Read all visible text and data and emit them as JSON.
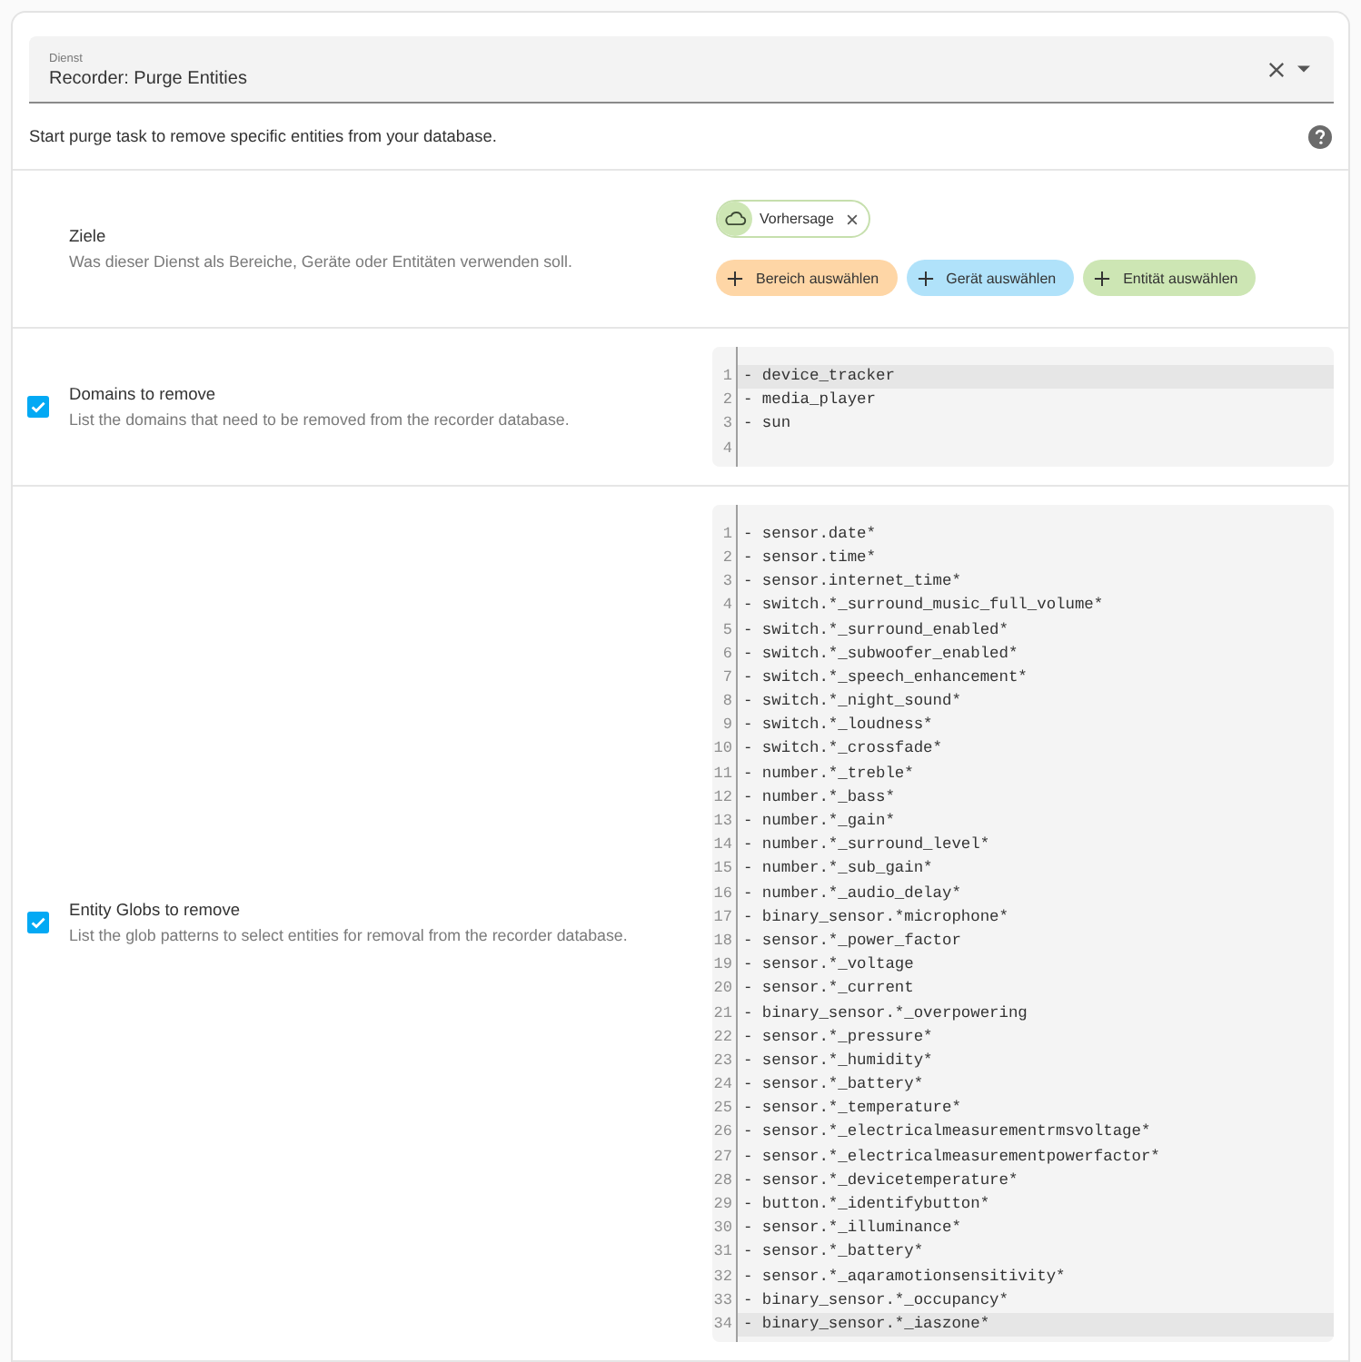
{
  "service_field": {
    "label": "Dienst",
    "value": "Recorder: Purge Entities"
  },
  "description": "Start purge task to remove specific entities from your database.",
  "sections": [
    {
      "kind": "targets",
      "title": "Ziele",
      "description": "Was dieser Dienst als Bereiche, Geräte oder Entitäten verwenden soll.",
      "chips": [
        {
          "label": "Vorhersage"
        }
      ],
      "add_buttons": [
        {
          "label": "Bereich auswählen",
          "color": "#fed6a6"
        },
        {
          "label": "Gerät auswählen",
          "color": "#b0e2fa"
        },
        {
          "label": "Entität auswählen",
          "color": "#cde6b4"
        }
      ]
    },
    {
      "kind": "code",
      "checked": true,
      "title": "Domains to remove",
      "description": "List the domains that need to be removed from the recorder database.",
      "lines": [
        {
          "number": "1",
          "text": "- device_tracker",
          "active": true
        },
        {
          "number": "2",
          "text": "- media_player",
          "active": false
        },
        {
          "number": "3",
          "text": "- sun",
          "active": false
        },
        {
          "number": "4",
          "active": false
        }
      ]
    },
    {
      "kind": "code",
      "checked": true,
      "title": "Entity Globs to remove",
      "description": "List the glob patterns to select entities for removal from the recorder database.",
      "lines": [
        {
          "number": "1",
          "text": "- sensor.date*",
          "active": false
        },
        {
          "number": "2",
          "text": "- sensor.time*",
          "active": false
        },
        {
          "number": "3",
          "text": "- sensor.internet_time*",
          "active": false
        },
        {
          "number": "4",
          "text": "- switch.*_surround_music_full_volume*",
          "active": false
        },
        {
          "number": "5",
          "text": "- switch.*_surround_enabled*",
          "active": false
        },
        {
          "number": "6",
          "text": "- switch.*_subwoofer_enabled*",
          "active": false
        },
        {
          "number": "7",
          "text": "- switch.*_speech_enhancement*",
          "active": false
        },
        {
          "number": "8",
          "text": "- switch.*_night_sound*",
          "active": false
        },
        {
          "number": "9",
          "text": "- switch.*_loudness*",
          "active": false
        },
        {
          "number": "10",
          "text": "- switch.*_crossfade*",
          "active": false
        },
        {
          "number": "11",
          "text": "- number.*_treble*",
          "active": false
        },
        {
          "number": "12",
          "text": "- number.*_bass*",
          "active": false
        },
        {
          "number": "13",
          "text": "- number.*_gain*",
          "active": false
        },
        {
          "number": "14",
          "text": "- number.*_surround_level*",
          "active": false
        },
        {
          "number": "15",
          "text": "- number.*_sub_gain*",
          "active": false
        },
        {
          "number": "16",
          "text": "- number.*_audio_delay*",
          "active": false
        },
        {
          "number": "17",
          "text": "- binary_sensor.*microphone*",
          "active": false
        },
        {
          "number": "18",
          "text": "- sensor.*_power_factor",
          "active": false
        },
        {
          "number": "19",
          "text": "- sensor.*_voltage",
          "active": false
        },
        {
          "number": "20",
          "text": "- sensor.*_current",
          "active": false
        },
        {
          "number": "21",
          "text": "- binary_sensor.*_overpowering",
          "active": false
        },
        {
          "number": "22",
          "text": "- sensor.*_pressure*",
          "active": false
        },
        {
          "number": "23",
          "text": "- sensor.*_humidity*",
          "active": false
        },
        {
          "number": "24",
          "text": "- sensor.*_battery*",
          "active": false
        },
        {
          "number": "25",
          "text": "- sensor.*_temperature*",
          "active": false
        },
        {
          "number": "26",
          "text": "- sensor.*_electricalmeasurementrmsvoltage*",
          "active": false
        },
        {
          "number": "27",
          "text": "- sensor.*_electricalmeasurementpowerfactor*",
          "active": false
        },
        {
          "number": "28",
          "text": "- sensor.*_devicetemperature*",
          "active": false
        },
        {
          "number": "29",
          "text": "- button.*_identifybutton*",
          "active": false
        },
        {
          "number": "30",
          "text": "- sensor.*_illuminance*",
          "active": false
        },
        {
          "number": "31",
          "text": "- sensor.*_battery*",
          "active": false
        },
        {
          "number": "32",
          "text": "- sensor.*_aqaramotionsensitivity*",
          "active": false
        },
        {
          "number": "33",
          "text": "- binary_sensor.*_occupancy*",
          "active": false
        },
        {
          "number": "34",
          "text": "- binary_sensor.*_iaszone*",
          "active": true
        }
      ]
    }
  ]
}
